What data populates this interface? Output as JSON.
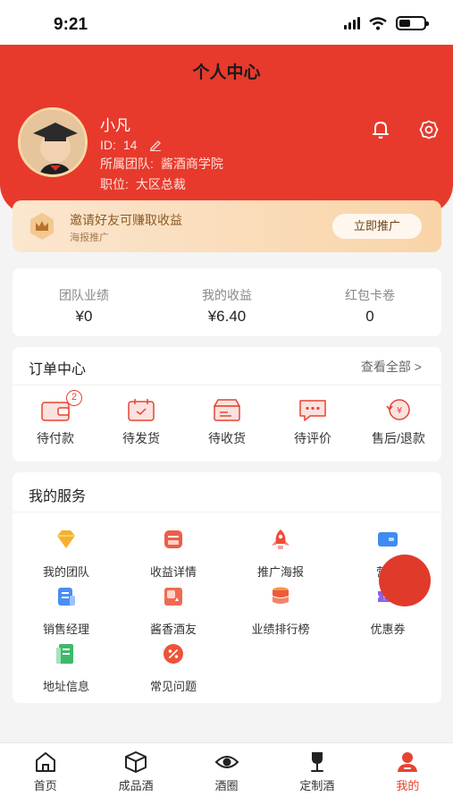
{
  "status_bar": {
    "time": "9:21"
  },
  "header": {
    "title": "个人中心"
  },
  "profile": {
    "name": "小凡",
    "id_label": "ID:",
    "id_value": "14",
    "team_label": "所属团队:",
    "team_value": "酱酒商学院",
    "position_label": "职位:",
    "position_value": "大区总裁"
  },
  "invite": {
    "title": "邀请好友可赚取收益",
    "subtitle": "海报推广",
    "button": "立即推广"
  },
  "stats": [
    {
      "label": "团队业绩",
      "value": "¥0"
    },
    {
      "label": "我的收益",
      "value": "¥6.40"
    },
    {
      "label": "红包卡卷",
      "value": "0"
    }
  ],
  "orders": {
    "title": "订单中心",
    "see_all": "查看全部 >",
    "pending_pay_badge": "2",
    "items": [
      {
        "label": "待付款",
        "icon": "wallet-icon"
      },
      {
        "label": "待发货",
        "icon": "calendar-box-icon"
      },
      {
        "label": "待收货",
        "icon": "delivery-box-icon"
      },
      {
        "label": "待评价",
        "icon": "comment-icon"
      },
      {
        "label": "售后/退款",
        "icon": "refund-icon"
      }
    ]
  },
  "services": {
    "title": "我的服务",
    "items": [
      {
        "label": "我的团队",
        "icon": "diamond-icon"
      },
      {
        "label": "收益详情",
        "icon": "income-icon"
      },
      {
        "label": "推广海报",
        "icon": "rocket-icon"
      },
      {
        "label": "营销",
        "icon": "card-icon"
      },
      {
        "label": "销售经理",
        "icon": "manager-icon"
      },
      {
        "label": "酱香酒友",
        "icon": "friend-icon"
      },
      {
        "label": "业绩排行榜",
        "icon": "ranking-icon"
      },
      {
        "label": "优惠券",
        "icon": "coupon-icon"
      },
      {
        "label": "地址信息",
        "icon": "address-icon"
      },
      {
        "label": "常见问题",
        "icon": "faq-icon"
      }
    ]
  },
  "tabbar": [
    {
      "label": "首页",
      "icon": "home-icon"
    },
    {
      "label": "成品酒",
      "icon": "cube-icon"
    },
    {
      "label": "酒圈",
      "icon": "eye-icon"
    },
    {
      "label": "定制酒",
      "icon": "wine-glass-icon"
    },
    {
      "label": "我的",
      "icon": "user-icon"
    }
  ],
  "colors": {
    "primary": "#e73a2c",
    "accent_text": "#e64433",
    "invite_bg": "#fbe1c4"
  }
}
